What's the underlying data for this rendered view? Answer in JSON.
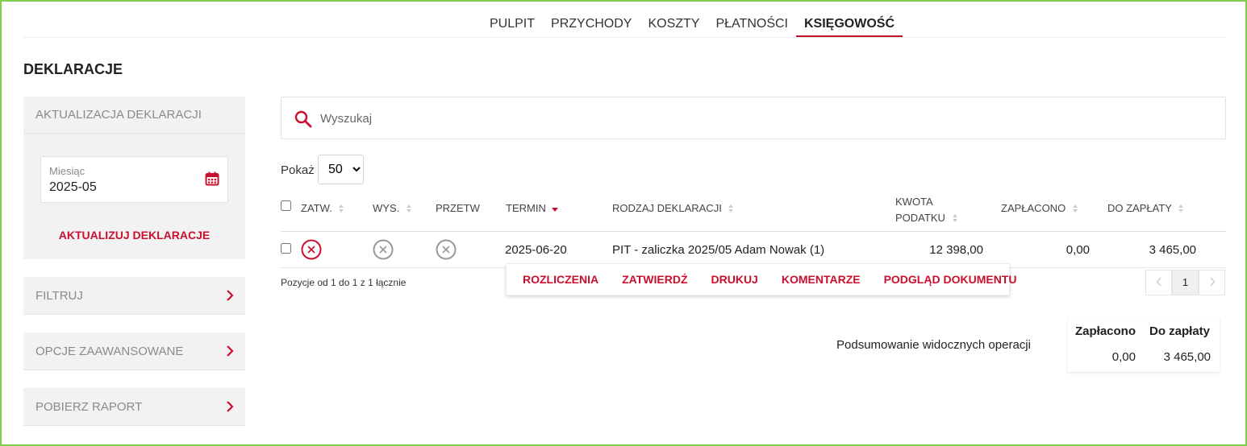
{
  "nav": {
    "tabs": [
      "PULPIT",
      "PRZYCHODY",
      "KOSZTY",
      "PŁATNOŚCI",
      "KSIĘGOWOŚĆ"
    ],
    "active": "KSIĘGOWOŚĆ"
  },
  "page_title": "DEKLARACJE",
  "left": {
    "update_section": "AKTUALIZACJA DEKLARACJI",
    "month_label": "Miesiąc",
    "month_value": "2025-05",
    "update_button": "AKTUALIZUJ DEKLARACJE",
    "filter": "FILTRUJ",
    "advanced": "OPCJE ZAAWANSOWANE",
    "report": "POBIERZ RAPORT"
  },
  "search": {
    "placeholder": "Wyszukaj"
  },
  "show": {
    "label": "Pokaż",
    "value": "50",
    "options": [
      "50"
    ]
  },
  "table": {
    "headers": {
      "approved": "ZATW.",
      "sent": "WYS.",
      "processed": "PRZETW",
      "deadline": "TERMIN",
      "type": "RODZAJ DEKLARACJI",
      "amount_line1": "KWOTA",
      "amount_line2": "PODATKU",
      "paid": "ZAPŁACONO",
      "due": "DO ZAPŁATY"
    },
    "rows": [
      {
        "deadline": "2025-06-20",
        "type": "PIT - zaliczka 2025/05 Adam Nowak (1)",
        "amount": "12 398,00",
        "paid": "0,00",
        "due": "3 465,00"
      }
    ]
  },
  "row_actions": [
    "ROZLICZENIA",
    "ZATWIERDŹ",
    "DRUKUJ",
    "KOMENTARZE",
    "PODGLĄD DOKUMENTU"
  ],
  "info": "Pozycje od 1 do 1 z 1 łącznie",
  "pager": {
    "current": "1"
  },
  "summary": {
    "label": "Podsumowanie widocznych operacji",
    "paid_header": "Zapłacono",
    "due_header": "Do zapłaty",
    "paid_value": "0,00",
    "due_value": "3 465,00"
  },
  "colors": {
    "accent": "#c8102e",
    "frame": "#7ed04b"
  }
}
